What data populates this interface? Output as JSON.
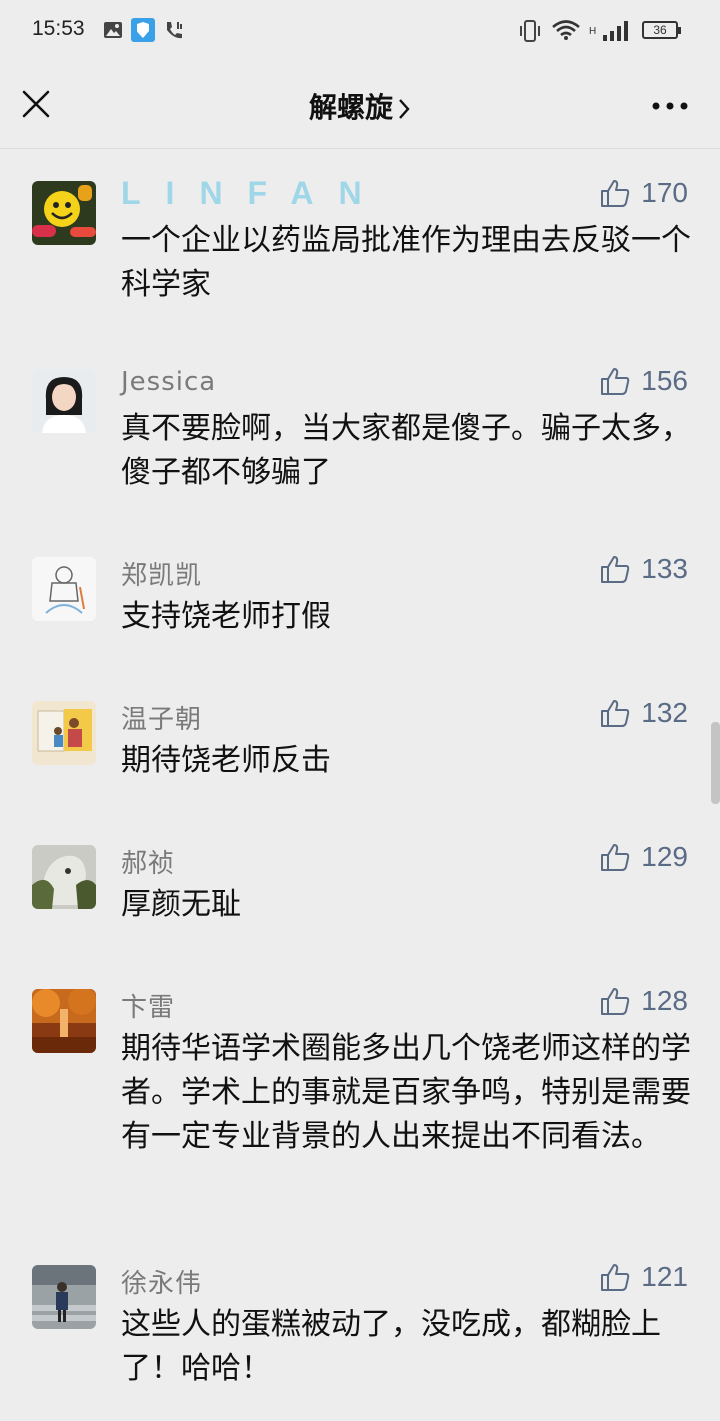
{
  "status": {
    "time": "15:53",
    "network_label": "H",
    "battery": "36"
  },
  "nav": {
    "title": "解螺旋"
  },
  "comments": [
    {
      "name": "LINFAN",
      "likes": "170",
      "text": "一个企业以药监局批准作为理由去反驳一个科学家"
    },
    {
      "name": "Jessica",
      "likes": "156",
      "text": "真不要脸啊，当大家都是傻子。骗子太多，傻子都不够骗了"
    },
    {
      "name": "郑凯凯",
      "likes": "133",
      "text": "支持饶老师打假"
    },
    {
      "name": "温子朝",
      "likes": "132",
      "text": "期待饶老师反击"
    },
    {
      "name": "郝祯",
      "likes": "129",
      "text": "厚颜无耻"
    },
    {
      "name": "卞雷",
      "likes": "128",
      "text": "期待华语学术圈能多出几个饶老师这样的学者。学术上的事就是百家争鸣，特别是需要有一定专业背景的人出来提出不同看法。"
    },
    {
      "name": "徐永伟",
      "likes": "121",
      "text": "这些人的蛋糕被动了，没吃成，都糊脸上了！哈哈！"
    }
  ],
  "colors": {
    "background": "#ededed",
    "like_color": "#5a6b86",
    "name_color": "#7a7a7a"
  }
}
